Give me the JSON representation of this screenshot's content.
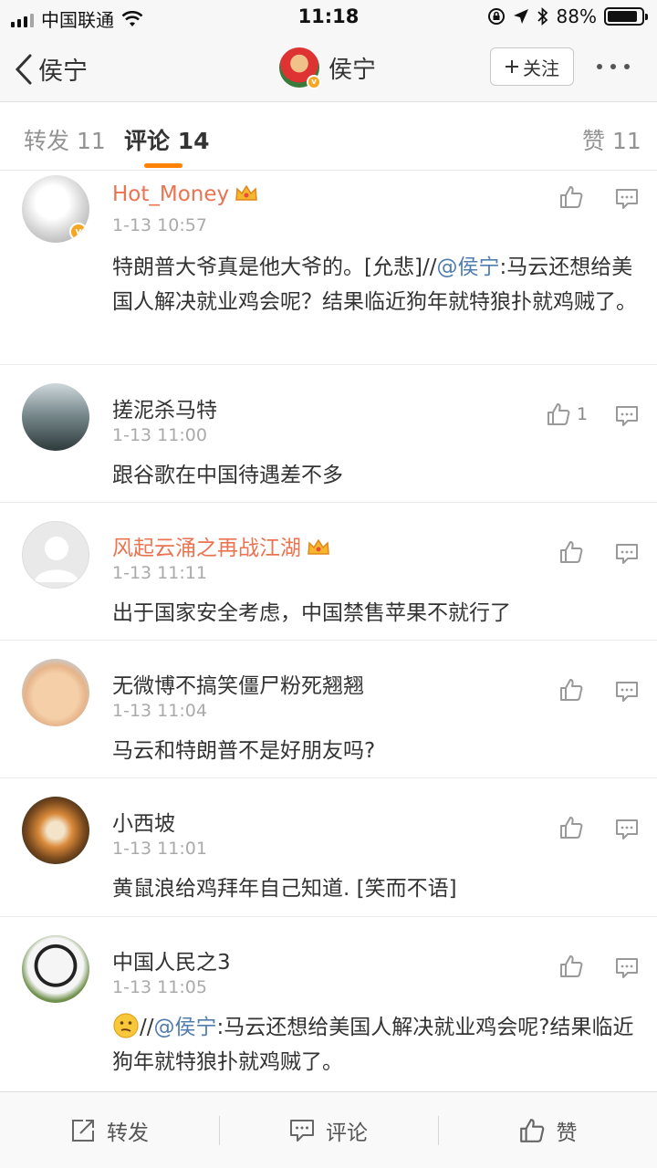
{
  "status_bar": {
    "carrier": "中国联通",
    "time": "11:18",
    "battery_percent": "88%",
    "battery_level": 0.88
  },
  "nav": {
    "back_label": "侯宁",
    "title": "侯宁",
    "follow_label": "关注"
  },
  "tabs": {
    "repost": "转发 11",
    "comment": "评论 14",
    "like": "赞 11"
  },
  "comments": [
    {
      "name": "Hot_Money",
      "vip": true,
      "time": "1-13 10:57",
      "text_plain": "特朗普大爷真是他大爷的。[允悲]//",
      "mention": "@侯宁",
      "text_after": ":马云还想给美国人解决就业鸡会呢？结果临近狗年就特狼扑就鸡贼了。",
      "likes": ""
    },
    {
      "name": "搓泥杀马特",
      "vip": false,
      "time": "1-13 11:00",
      "text_plain": "跟谷歌在中国待遇差不多",
      "likes": "1"
    },
    {
      "name": "风起云涌之再战江湖",
      "vip": true,
      "time": "1-13 11:11",
      "text_plain": "出于国家安全考虑，中国禁售苹果不就行了",
      "likes": ""
    },
    {
      "name": "无微博不搞笑僵尸粉死翘翘",
      "vip": false,
      "time": "1-13 11:04",
      "text_plain": "马云和特朗普不是好朋友吗?",
      "likes": ""
    },
    {
      "name": "小西坡",
      "vip": false,
      "time": "1-13 11:01",
      "text_plain": "黄鼠浪给鸡拜年自己知道.  [笑而不语]",
      "likes": ""
    },
    {
      "name": "中国人民之3",
      "vip": false,
      "time": "1-13 11:05",
      "text_prefix": "//",
      "mention": "@侯宁",
      "text_after": ":马云还想给美国人解决就业鸡会呢?结果临近狗年就特狼扑就鸡贼了。",
      "likes": ""
    }
  ],
  "toolbar": {
    "repost": "转发",
    "comment": "评论",
    "like": "赞"
  },
  "colors": {
    "accent": "#ff8200",
    "vip_name": "#eb7350",
    "link": "#507daf"
  },
  "icons": [
    "wifi-icon",
    "lock-rotation-icon",
    "location-icon",
    "bluetooth-icon",
    "thumb-up-icon",
    "reply-bubble-icon",
    "repost-icon",
    "comment-icon",
    "crown-icon"
  ]
}
